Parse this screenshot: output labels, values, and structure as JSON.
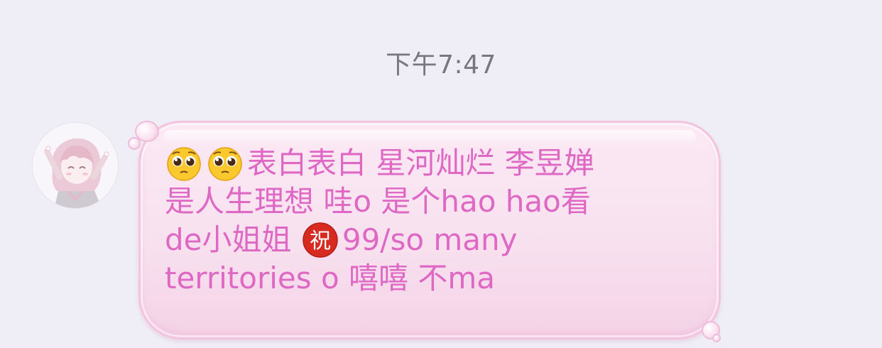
{
  "timestamp": "下午7:47",
  "message": {
    "sender_avatar": "anime-girl-avatar",
    "colors": {
      "text": "#de68c4",
      "bubble_border": "#f3c3df",
      "bubble_fill": "#f8e1ef",
      "background": "#efeef6"
    },
    "line1": "表白表白 星河灿烂 李昱婵",
    "line2": "是人生理想 哇o 是个hao hao看",
    "line3_prefix": "de小姐姐 ",
    "line3_suffix": "99/so many",
    "line4": "territories o 嘻嘻 不ma",
    "emojis": [
      "pleading-face-emoji",
      "pleading-face-emoji",
      "congratulations-emoji"
    ],
    "congrats_glyph": "祝"
  }
}
